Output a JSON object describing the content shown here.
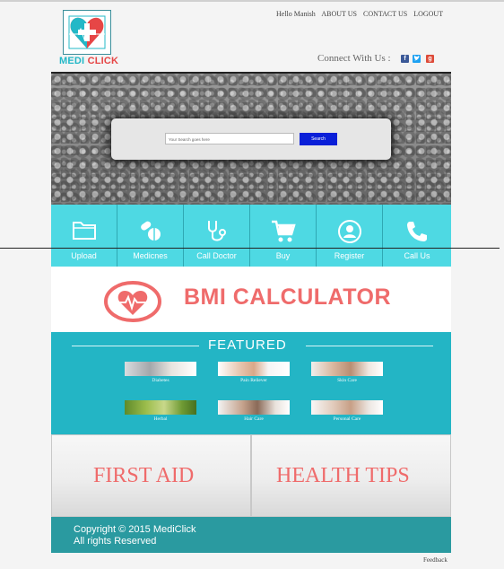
{
  "brand": {
    "part1": "MEDI",
    "part2": "CLICK"
  },
  "topnav": {
    "greeting": "Hello Manish",
    "about": "ABOUT US",
    "contact": "CONTACT US",
    "logout": "LOGOUT"
  },
  "connect": {
    "label": "Connect With Us :",
    "social": [
      "facebook-icon",
      "twitter-icon",
      "google-plus-icon"
    ]
  },
  "search": {
    "placeholder": "Your Search goes here",
    "button": "Search"
  },
  "services": [
    {
      "label": "Upload",
      "icon": "folder-icon"
    },
    {
      "label": "Medicnes",
      "icon": "pills-icon"
    },
    {
      "label": "Call Doctor",
      "icon": "stethoscope-icon"
    },
    {
      "label": "Buy",
      "icon": "cart-icon"
    },
    {
      "label": "Register",
      "icon": "user-icon"
    },
    {
      "label": "Call Us",
      "icon": "phone-icon"
    }
  ],
  "bmi": {
    "title": "BMI CALCULATOR"
  },
  "featured": {
    "title": "FEATURED",
    "items": [
      "Diabetes",
      "Pain Reliever",
      "Skin Care",
      "Herbal",
      "Hair Care",
      "Personal Care"
    ]
  },
  "panels": {
    "first_aid": "FIRST AID",
    "health_tips": "HEALTH TIPS"
  },
  "footer": {
    "line1": "Copyright © 2015 MediClick",
    "line2": "All rights Reserved"
  },
  "feedback": "Feedback",
  "colors": {
    "teal": "#23b5c5",
    "iconbar": "#4ed9e3",
    "coral": "#ef6b6b",
    "footer": "#2a9aa0",
    "search_button": "#0a1fd8"
  }
}
